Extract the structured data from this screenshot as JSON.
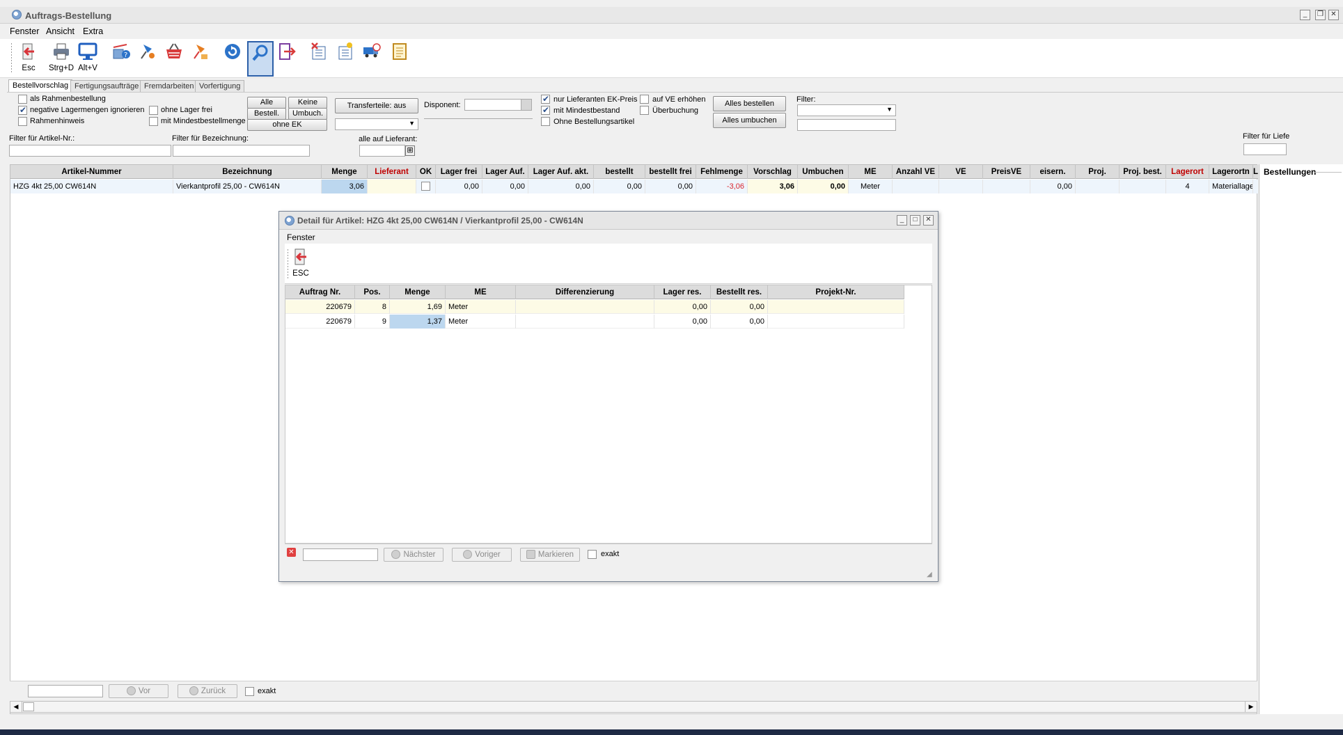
{
  "window": {
    "title": "Auftrags-Bestellung"
  },
  "menu": [
    "Fenster",
    "Ansicht",
    "Extra"
  ],
  "toolbar": {
    "esc_label": "Esc",
    "print_label": "Strg+D",
    "view_label": "Alt+V"
  },
  "tabs": [
    "Bestellvorschlag",
    "Fertigungsaufträge",
    "Fremdarbeiten",
    "Vorfertigung"
  ],
  "filters": {
    "cb_rahmenbestellung": "als Rahmenbestellung",
    "cb_negative": "negative Lagermengen ignorieren",
    "cb_rahmenhinweis": "Rahmenhinweis",
    "cb_ohne_lager": "ohne Lager frei",
    "cb_mindest": "mit Mindestbestellmenge",
    "btn_alle": "Alle",
    "btn_keine": "Keine",
    "btn_bestell": "Bestell.",
    "btn_umbuch": "Umbuch.",
    "btn_ohne_ek": "ohne EK",
    "btn_transfer": "Transferteile: aus",
    "disponent_label": "Disponent:",
    "cb_nur_lieferanten": "nur Lieferanten EK-Preis",
    "cb_mit_mindestbestand": "mit Mindestbestand",
    "cb_ohne_bestellartikel": "Ohne Bestellungsartikel",
    "cb_auf_ve": "auf VE erhöhen",
    "cb_ueberbuchung": "Überbuchung",
    "btn_alles_bestellen": "Alles bestellen",
    "btn_alles_umbuchen": "Alles umbuchen",
    "filter_label": "Filter:",
    "filter_artikel_label": "Filter für Artikel-Nr.:",
    "filter_bez_label": "Filter für Bezeichnung:",
    "alle_lieferant_label": "alle auf Lieferant:",
    "filter_liefe_label": "Filter für Liefe"
  },
  "grid": {
    "columns": [
      "Artikel-Nummer",
      "Bezeichnung",
      "Menge",
      "Lieferant",
      "OK",
      "Lager frei",
      "Lager Auf.",
      "Lager Auf. akt.",
      "bestellt",
      "bestellt frei",
      "Fehlmenge",
      "Vorschlag",
      "Umbuchen",
      "ME",
      "Anzahl VE",
      "VE",
      "PreisVE",
      "eisern.",
      "Proj.",
      "Proj. best.",
      "Lagerort",
      "Lagerortn",
      "Lie"
    ],
    "rows": [
      {
        "artikel": "HZG 4kt 25,00 CW614N",
        "bezeichnung": "Vierkantprofil 25,00 - CW614N",
        "menge": "3,06",
        "lager_frei": "0,00",
        "lager_auf": "0,00",
        "lager_auf_akt": "0,00",
        "bestellt": "0,00",
        "bestellt_frei": "0,00",
        "fehlmenge": "-3,06",
        "vorschlag": "3,06",
        "umbuchen": "0,00",
        "me": "Meter",
        "eisern": "0,00",
        "lagerort": "4",
        "lagerortn": "Materiallage"
      }
    ]
  },
  "right_panel": {
    "title": "Bestellungen"
  },
  "bottom": {
    "vor": "Vor",
    "zurueck": "Zurück",
    "exakt": "exakt"
  },
  "dialog": {
    "title": "Detail für Artikel: HZG 4kt 25,00 CW614N / Vierkantprofil 25,00 - CW614N",
    "menu": "Fenster",
    "esc_label": "ESC",
    "columns": [
      "Auftrag Nr.",
      "Pos.",
      "Menge",
      "ME",
      "Differenzierung",
      "Lager res.",
      "Bestellt res.",
      "Projekt-Nr."
    ],
    "rows": [
      {
        "auftrag": "220679",
        "pos": "8",
        "menge": "1,69",
        "me": "Meter",
        "diff": "",
        "lager_res": "0,00",
        "bestellt_res": "0,00",
        "projekt": ""
      },
      {
        "auftrag": "220679",
        "pos": "9",
        "menge": "1,37",
        "me": "Meter",
        "diff": "",
        "lager_res": "0,00",
        "bestellt_res": "0,00",
        "projekt": ""
      }
    ],
    "search": {
      "naechster": "Nächster",
      "voriger": "Voriger",
      "markieren": "Markieren",
      "exakt": "exakt"
    }
  }
}
